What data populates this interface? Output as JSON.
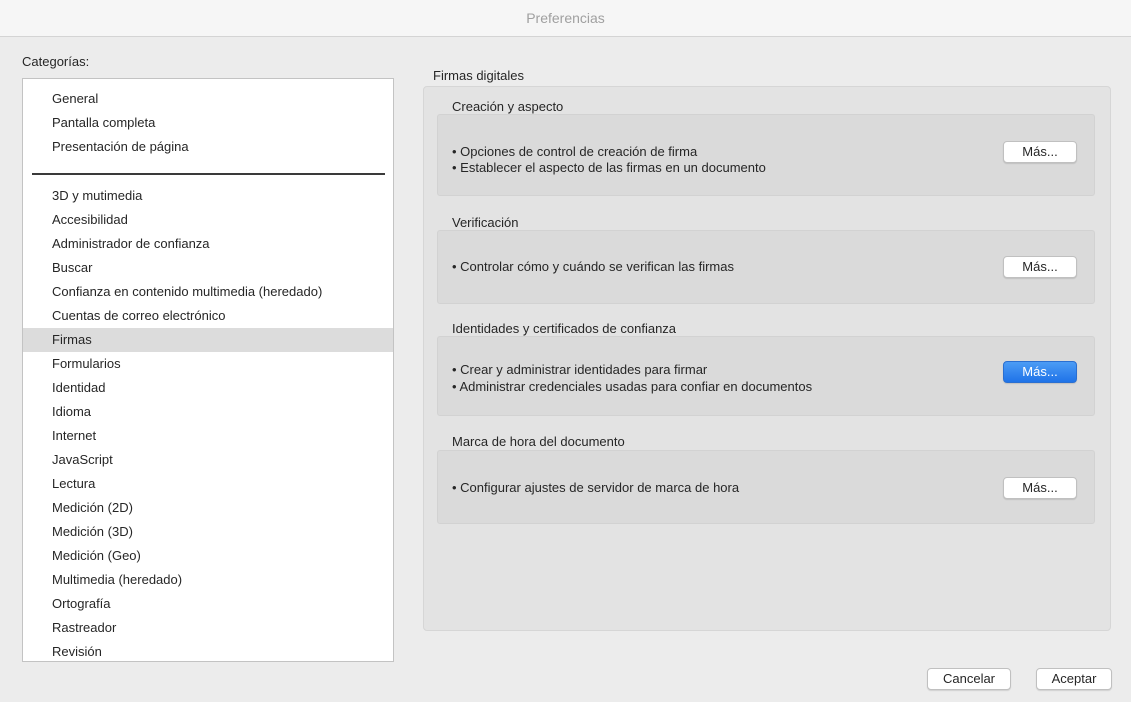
{
  "window": {
    "title": "Preferencias"
  },
  "categories": {
    "label": "Categorías:",
    "top_items": [
      "General",
      "Pantalla completa",
      "Presentación de página"
    ],
    "items": [
      "3D y mutimedia",
      "Accesibilidad",
      "Administrador de confianza",
      "Buscar",
      "Confianza en contenido multimedia (heredado)",
      "Cuentas de correo electrónico",
      "Firmas",
      "Formularios",
      "Identidad",
      "Idioma",
      "Internet",
      "JavaScript",
      "Lectura",
      "Medición (2D)",
      "Medición (3D)",
      "Medición (Geo)",
      "Multimedia (heredado)",
      "Ortografía",
      "Rastreador",
      "Revisión"
    ],
    "selected": "Firmas"
  },
  "panel": {
    "title": "Firmas digitales",
    "groups": [
      {
        "title": "Creación y aspecto",
        "bullets": [
          "• Opciones de control de creación de firma",
          "• Establecer el aspecto de las firmas en un documento"
        ],
        "button_label": "Más..."
      },
      {
        "title": "Verificación",
        "bullets": [
          "• Controlar cómo y cuándo se verifican las firmas"
        ],
        "button_label": "Más..."
      },
      {
        "title": "Identidades y certificados de confianza",
        "bullets": [
          "• Crear y administrar identidades para firmar",
          "• Administrar credenciales usadas para confiar en documentos"
        ],
        "button_label": "Más..."
      },
      {
        "title": "Marca de hora del documento",
        "bullets": [
          "• Configurar ajustes de servidor de marca de hora"
        ],
        "button_label": "Más..."
      }
    ]
  },
  "footer": {
    "cancel_label": "Cancelar",
    "accept_label": "Aceptar"
  },
  "colors": {
    "background": "#ececec",
    "selection": "#dcdcdc",
    "accent": "#1f73e8",
    "panel": "#e3e3e3"
  }
}
